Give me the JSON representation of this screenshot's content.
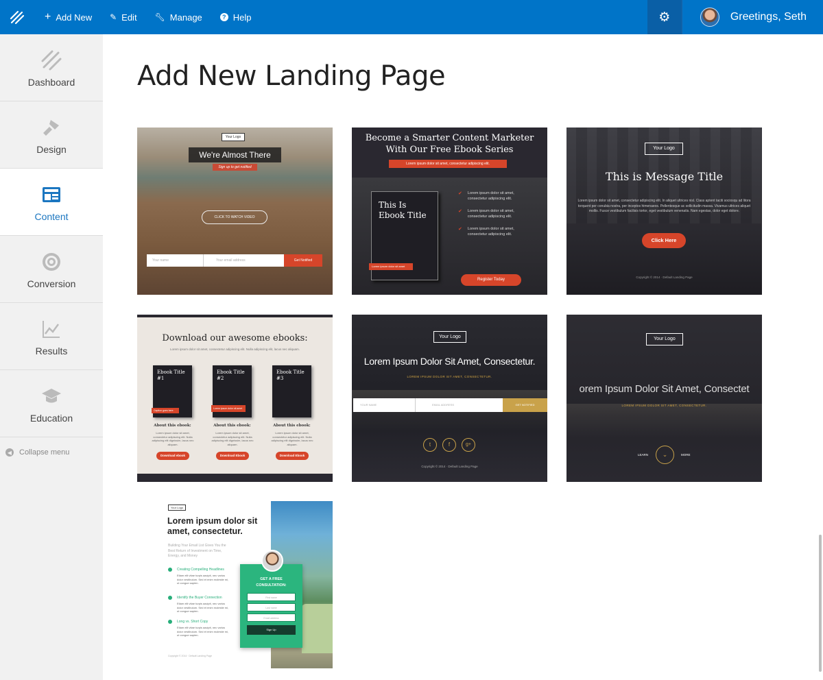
{
  "topbar": {
    "add_new": "Add New",
    "edit": "Edit",
    "manage": "Manage",
    "help": "Help",
    "greeting": "Greetings, Seth"
  },
  "sidebar": {
    "items": [
      {
        "label": "Dashboard"
      },
      {
        "label": "Design"
      },
      {
        "label": "Content"
      },
      {
        "label": "Conversion"
      },
      {
        "label": "Results"
      },
      {
        "label": "Education"
      }
    ],
    "collapse": "Collapse menu"
  },
  "page": {
    "title": "Add New Landing Page"
  },
  "templates": {
    "t1": {
      "logo": "Your Logo",
      "headline": "We're Almost There",
      "sub": "Sign up to get notified",
      "video": "CLICK TO WATCH VIDEO",
      "name_ph": "Your name",
      "email_ph": "Your email address",
      "cta": "Get Notified"
    },
    "t2": {
      "headline1": "Become a Smarter Content Marketer",
      "headline2": "With Our Free Ebook Series",
      "band": "Lorem ipsum dolor sit amet, consectetur adipiscing elit.",
      "book1": "This Is",
      "book2": "Ebook Title",
      "book_tag": "Lorem ipsum dolor sit amet",
      "bullet": "Lorem ipsum dolor sit amet, consectetur adipiscing elit.",
      "cta": "Register Today"
    },
    "t3": {
      "logo": "Your Logo",
      "title": "This is Message Title",
      "body": "Lorem ipsum dolor sit amet, consectetur adipiscing elit. In aliquet ultrices nisl. Class aptent taciti sociosqu ad litora torquent per conubia nostra, per inceptos himenaeos. Pellentesque ac sollicitudin massa. Vivamus ultrices aliquet mollis. Fusce vestibulum facilisis tortor, eget vestibulum venenatis. Nam egestas, dolor eget dolore.",
      "cta": "Click Here",
      "copy": "Copyright © 2014 · Default Landing Page"
    },
    "t4": {
      "title": "Download our awesome ebooks:",
      "sub": "Lorem ipsum dolor sit amet, consectetur adipiscing elit. Nulla adipiscing elit, lacus nec aliquam.",
      "books": [
        {
          "title": "Ebook Title",
          "num": "#1",
          "tag": "Caption goes here"
        },
        {
          "title": "Ebook Title",
          "num": "#2",
          "tag": "Lorem ipsum dolor sit amet"
        },
        {
          "title": "Ebook Title",
          "num": "#3",
          "tag": ""
        }
      ],
      "about": "About this ebook:",
      "desc": "Lorem ipsum dolor sit amet, consectetur adipiscing elit. Nulla adipiscing elit dignissim, lacus nec aliquam.",
      "cta1": "Download ebook",
      "cta2": "Download Ebook",
      "cta3": "Download Ebook"
    },
    "t5": {
      "logo": "Your Logo",
      "headline": "Lorem Ipsum Dolor Sit Amet, Consectetur.",
      "sub": "LOREM IPSUM DOLOR SIT AMET, CONSECTETUR.",
      "name_ph": "YOUR NAME",
      "email_ph": "EMAIL ADDRESS",
      "cta": "GET NOTIFIED",
      "copy": "Copyright © 2014 · Default Landing Page"
    },
    "t6": {
      "logo": "Your Logo",
      "headline": "orem Ipsum Dolor Sit Amet, Consectet",
      "sub": "LOREM IPSUM DOLOR SIT AMET, CONSECTETUR.",
      "learn": "LEARN",
      "more": "MORE"
    },
    "t7": {
      "logo": "Your Logo",
      "headline": "Lorem ipsum dolor sit amet, consectetur.",
      "sub": "Building Your Email List Gives You the Best Return of Investment on Time, Energy, and Money",
      "items": [
        "Creating Compelling Headlines",
        "Identify the Buyer Connection",
        "Long vs. Short Copy"
      ],
      "item_body": "Etiam elit vitae turpis aacipit, nec varius dolor vestibulum. Sed et enim molestie mi, ut congue sapien.",
      "form_title": "GET A FREE CONSULTATION:",
      "first_ph": "First name",
      "last_ph": "Last name",
      "email_ph": "Email address",
      "cta": "Sign Up",
      "copy": "Copyright © 2014 · Default Landing Page"
    }
  }
}
